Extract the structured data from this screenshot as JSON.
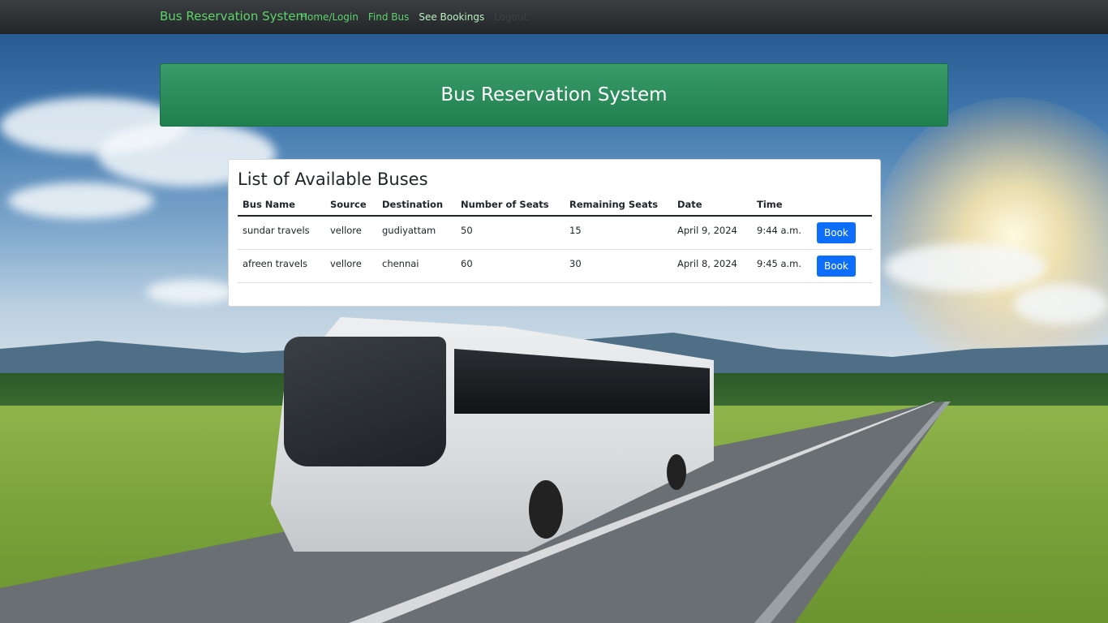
{
  "navbar": {
    "brand": "Bus Reservation System",
    "links": [
      "Home/Login",
      "Find Bus",
      "See Bookings",
      "Logout"
    ]
  },
  "header": {
    "title": "Bus Reservation System"
  },
  "buses": {
    "title": "List of Available Buses",
    "columns": [
      "Bus Name",
      "Source",
      "Destination",
      "Number of Seats",
      "Remaining Seats",
      "Date",
      "Time",
      ""
    ],
    "rows": [
      {
        "bus_name": "sundar travels",
        "source": "vellore",
        "destination": "gudiyattam",
        "seats": "50",
        "remaining": "15",
        "date": "April 9, 2024",
        "time": "9:44 a.m.",
        "action": "Book"
      },
      {
        "bus_name": "afreen travels",
        "source": "vellore",
        "destination": "chennai",
        "seats": "60",
        "remaining": "30",
        "date": "April 8, 2024",
        "time": "9:45 a.m.",
        "action": "Book"
      }
    ]
  },
  "colors": {
    "brand_green": "#5dd36a",
    "header_green": "#2a8c5a",
    "primary_button": "#0d6efd"
  }
}
